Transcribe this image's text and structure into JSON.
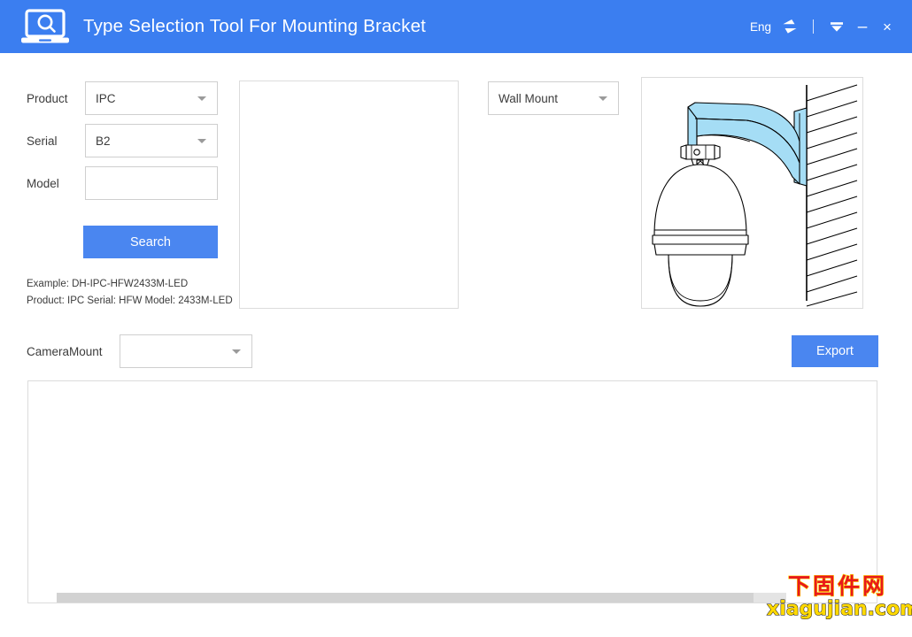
{
  "window": {
    "title": "Type Selection Tool For Mounting Bracket",
    "logo_icon": "laptop-search-icon",
    "language_label": "Eng",
    "language_switch_icon": "swap-arrows-icon",
    "tray_icon": "minimize-to-tray-icon",
    "minimize_label": "–",
    "close_label": "×",
    "header_color": "#3b7ef0"
  },
  "form": {
    "product": {
      "label": "Product",
      "value": "IPC",
      "placeholder": ""
    },
    "serial": {
      "label": "Serial",
      "value": "B2",
      "placeholder": ""
    },
    "model": {
      "label": "Model",
      "value": "",
      "placeholder": ""
    },
    "search_label": "Search",
    "example_line1": "Example: DH-IPC-HFW2433M-LED",
    "example_line2": "Product: IPC Serial: HFW Model: 2433M-LED",
    "camera_mount": {
      "label": "CameraMount",
      "value": "",
      "placeholder": ""
    },
    "button_color": "#4a86f0"
  },
  "mount": {
    "type_value": "Wall Mount",
    "preview_alt": "ptz-dome-camera-wall-mount-bracket",
    "bracket_color": "#a5ddf5"
  },
  "actions": {
    "export_label": "Export"
  },
  "results": {
    "rows": [],
    "columns": []
  },
  "watermark": {
    "cn": "下固件网",
    "en": "xiagujian.com",
    "cn_color": "#e8191c",
    "en_color": "#ffd900"
  }
}
